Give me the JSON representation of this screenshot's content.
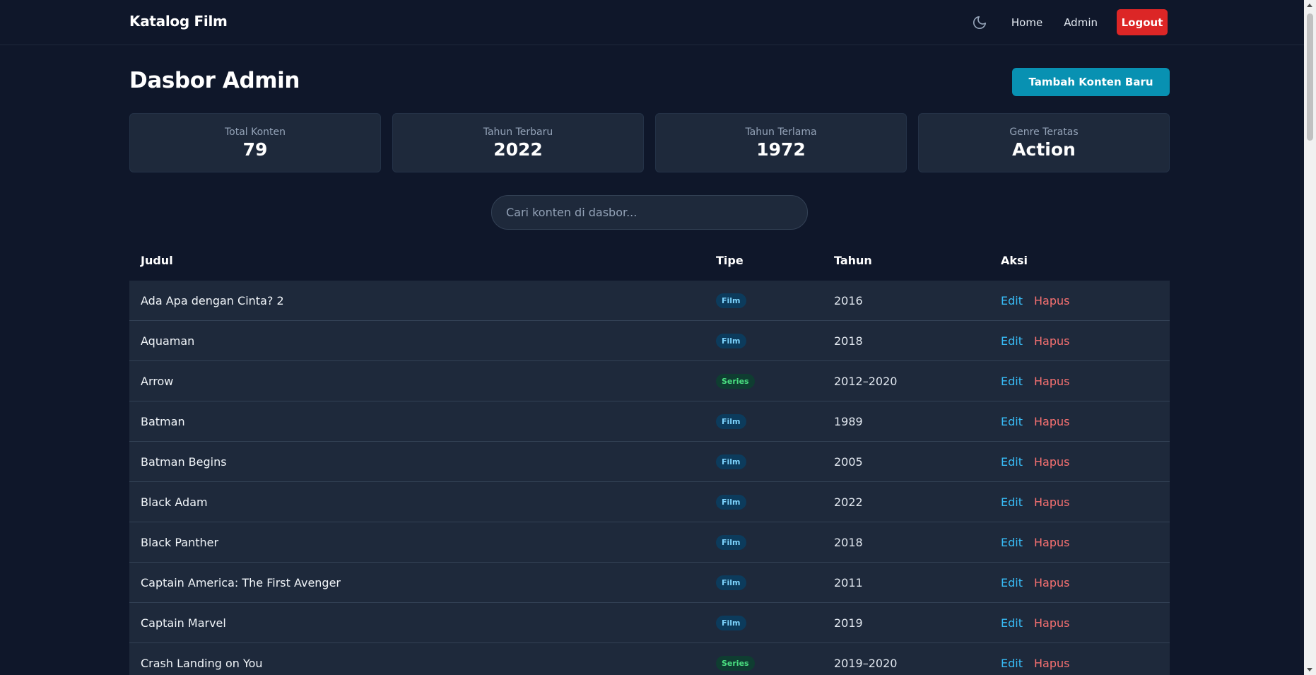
{
  "navbar": {
    "brand": "Katalog Film",
    "theme_icon": "moon-icon",
    "links": [
      {
        "label": "Home"
      },
      {
        "label": "Admin"
      }
    ],
    "logout_label": "Logout"
  },
  "page": {
    "title": "Dasbor Admin",
    "add_button_label": "Tambah Konten Baru"
  },
  "stats": [
    {
      "label": "Total Konten",
      "value": "79"
    },
    {
      "label": "Tahun Terbaru",
      "value": "2022"
    },
    {
      "label": "Tahun Terlama",
      "value": "1972"
    },
    {
      "label": "Genre Teratas",
      "value": "Action"
    }
  ],
  "search": {
    "placeholder": "Cari konten di dasbor...",
    "value": ""
  },
  "table": {
    "headers": {
      "title": "Judul",
      "type": "Tipe",
      "year": "Tahun",
      "actions": "Aksi"
    },
    "edit_label": "Edit",
    "delete_label": "Hapus",
    "rows": [
      {
        "title": "Ada Apa dengan Cinta? 2",
        "type": "Film",
        "year": "2016"
      },
      {
        "title": "Aquaman",
        "type": "Film",
        "year": "2018"
      },
      {
        "title": "Arrow",
        "type": "Series",
        "year": "2012–2020"
      },
      {
        "title": "Batman",
        "type": "Film",
        "year": "1989"
      },
      {
        "title": "Batman Begins",
        "type": "Film",
        "year": "2005"
      },
      {
        "title": "Black Adam",
        "type": "Film",
        "year": "2022"
      },
      {
        "title": "Black Panther",
        "type": "Film",
        "year": "2018"
      },
      {
        "title": "Captain America: The First Avenger",
        "type": "Film",
        "year": "2011"
      },
      {
        "title": "Captain Marvel",
        "type": "Film",
        "year": "2019"
      },
      {
        "title": "Crash Landing on You",
        "type": "Series",
        "year": "2019–2020"
      }
    ]
  },
  "colors": {
    "background": "#0f172a",
    "card": "#1e293b",
    "accent": "#0891b2",
    "logout": "#dc2626",
    "edit": "#38bdf8",
    "delete": "#f87171"
  }
}
